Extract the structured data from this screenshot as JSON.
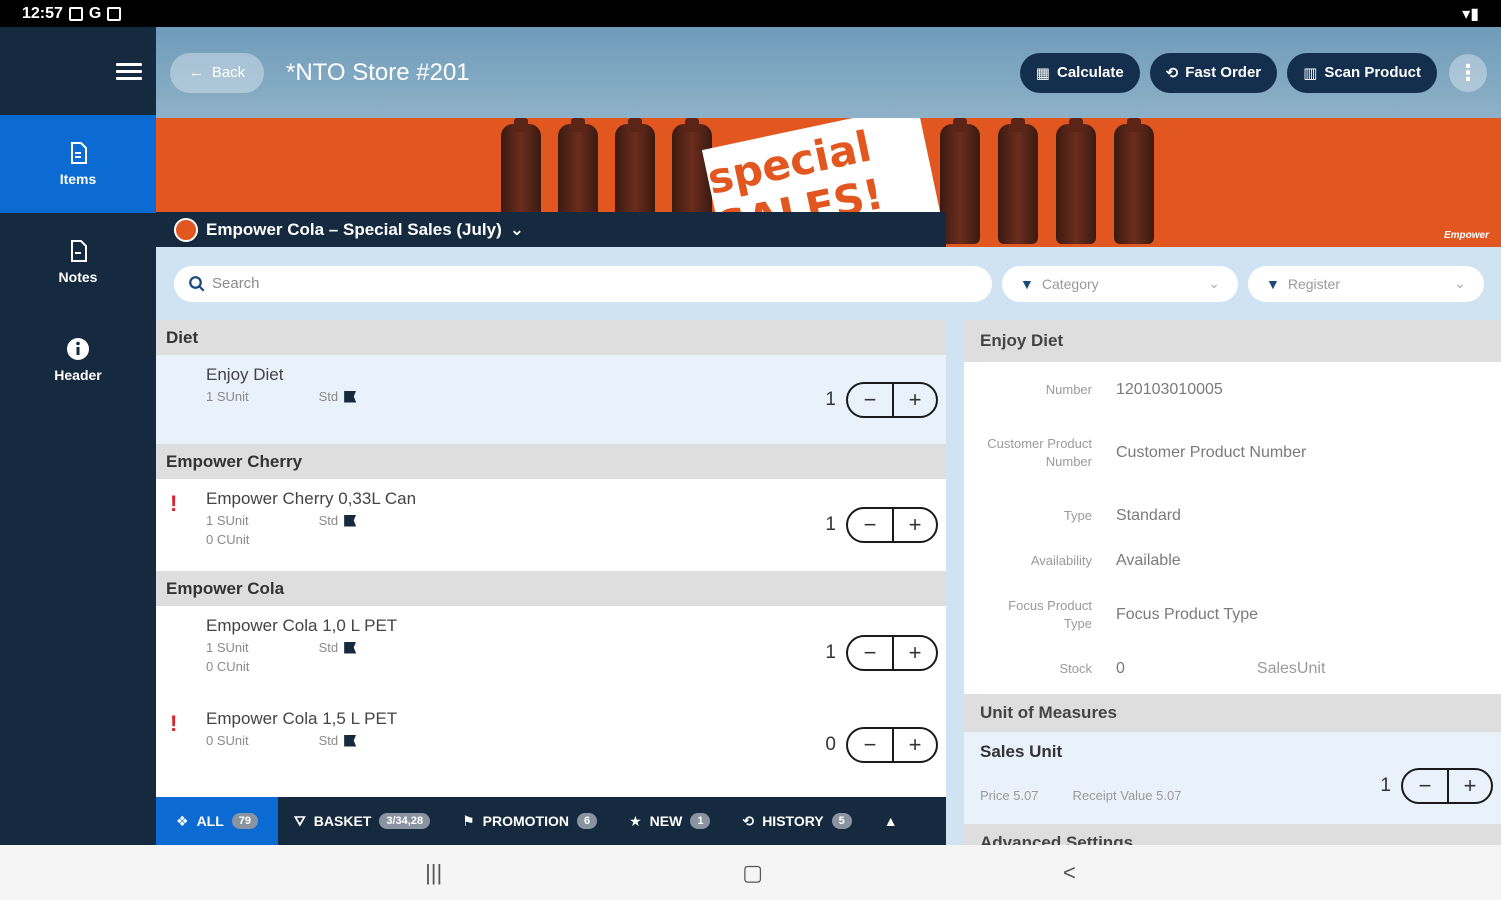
{
  "status_bar": {
    "time": "12:57",
    "google": "G"
  },
  "sidebar": {
    "items": [
      {
        "label": "Items",
        "icon": "document-icon"
      },
      {
        "label": "Notes",
        "icon": "document-icon"
      },
      {
        "label": "Header",
        "icon": "info-icon"
      }
    ]
  },
  "topbar": {
    "back_label": "Back",
    "store_title": "*NTO Store #201",
    "calculate_label": "Calculate",
    "fast_order_label": "Fast Order",
    "scan_product_label": "Scan Product"
  },
  "banner": {
    "sale_text": "special SALES!",
    "brand": "Empower"
  },
  "promotion": {
    "title": "Empower Cola – Special Sales (July)"
  },
  "filters": {
    "search_placeholder": "Search",
    "category_placeholder": "Category",
    "register_placeholder": "Register"
  },
  "groups": [
    {
      "name": "Diet",
      "items": [
        {
          "name": "Enjoy Diet",
          "sunit": "1 SUnit",
          "cunit": "",
          "std": "Std",
          "qty": "1",
          "warn": false,
          "selected": true
        }
      ]
    },
    {
      "name": "Empower Cherry",
      "items": [
        {
          "name": "Empower Cherry 0,33L Can",
          "sunit": "1 SUnit",
          "cunit": "0 CUnit",
          "std": "Std",
          "qty": "1",
          "warn": true,
          "selected": false
        }
      ]
    },
    {
      "name": "Empower Cola",
      "items": [
        {
          "name": "Empower Cola 1,0 L PET",
          "sunit": "1 SUnit",
          "cunit": "0 CUnit",
          "std": "Std",
          "qty": "1",
          "warn": false,
          "selected": false
        },
        {
          "name": "Empower Cola 1,5 L PET",
          "sunit": "0 SUnit",
          "cunit": "",
          "std": "Std",
          "qty": "0",
          "warn": true,
          "selected": false
        }
      ]
    }
  ],
  "bottom_tabs": [
    {
      "label": "ALL",
      "badge": "79"
    },
    {
      "label": "BASKET",
      "badge": "3/34,28"
    },
    {
      "label": "PROMOTION",
      "badge": "6"
    },
    {
      "label": "NEW",
      "badge": "1"
    },
    {
      "label": "HISTORY",
      "badge": "5"
    }
  ],
  "detail": {
    "title": "Enjoy Diet",
    "number_label": "Number",
    "number_value": "120103010005",
    "cpn_label": "Customer Product Number",
    "cpn_value": "Customer Product Number",
    "type_label": "Type",
    "type_value": "Standard",
    "availability_label": "Availability",
    "availability_value": "Available",
    "focus_label": "Focus Product Type",
    "focus_value": "Focus Product Type",
    "stock_label": "Stock",
    "stock_value": "0",
    "stock_unit": "SalesUnit",
    "uom_header": "Unit of Measures",
    "sales_unit_label": "Sales Unit",
    "sales_unit_qty": "1",
    "price": "Price 5.07",
    "receipt_value": "Receipt Value 5.07",
    "advanced_header": "Advanced Settings"
  },
  "colors": {
    "sidebar": "#152a3f",
    "accent": "#0b6bd3",
    "banner": "#e2571f",
    "warn": "#d9232f"
  }
}
